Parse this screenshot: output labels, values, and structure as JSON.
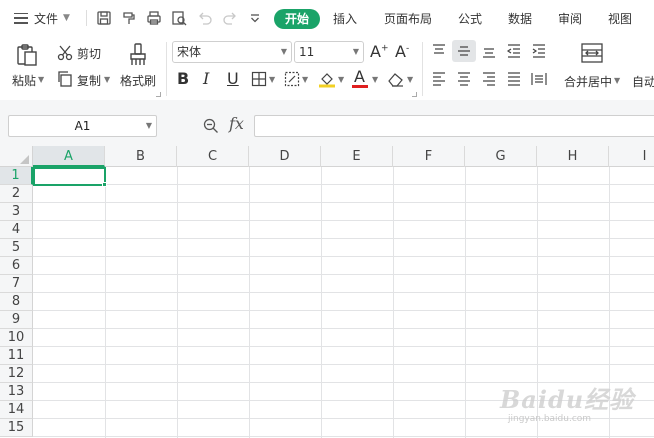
{
  "menubar": {
    "file_label": "文件",
    "tabs": [
      {
        "label": "开始",
        "active": true
      },
      {
        "label": "插入"
      },
      {
        "label": "页面布局"
      },
      {
        "label": "公式"
      },
      {
        "label": "数据"
      },
      {
        "label": "审阅"
      },
      {
        "label": "视图"
      }
    ],
    "quick_access_icons": [
      "save-icon",
      "format-painter-icon",
      "print-icon",
      "print-preview-icon",
      "undo-icon",
      "redo-icon",
      "customize-chevron-icon"
    ]
  },
  "ribbon": {
    "clipboard": {
      "paste_label": "粘贴",
      "cut_label": "剪切",
      "copy_label": "复制",
      "format_painter_label": "格式刷"
    },
    "font": {
      "family": "宋体",
      "size": "11",
      "grow_symbol": "A",
      "shrink_symbol": "A",
      "bold": "B",
      "italic": "I",
      "underline": "U",
      "font_color_letter": "A"
    },
    "alignment": {
      "merge_center_label": "合并居中",
      "wrap_text_label": "自动"
    }
  },
  "formula_bar": {
    "name_box": "A1",
    "fx_label": "fx",
    "formula": ""
  },
  "sheet": {
    "columns": [
      "A",
      "B",
      "C",
      "D",
      "E",
      "F",
      "G",
      "H",
      "I"
    ],
    "rows": [
      "1",
      "2",
      "3",
      "4",
      "5",
      "6",
      "7",
      "8",
      "9",
      "10",
      "11",
      "12",
      "13",
      "14",
      "15"
    ],
    "active_cell": "A1",
    "accent_color": "#1aa368"
  },
  "watermark": {
    "main": "Baidu经验",
    "sub": "jingyan.baidu.com"
  }
}
